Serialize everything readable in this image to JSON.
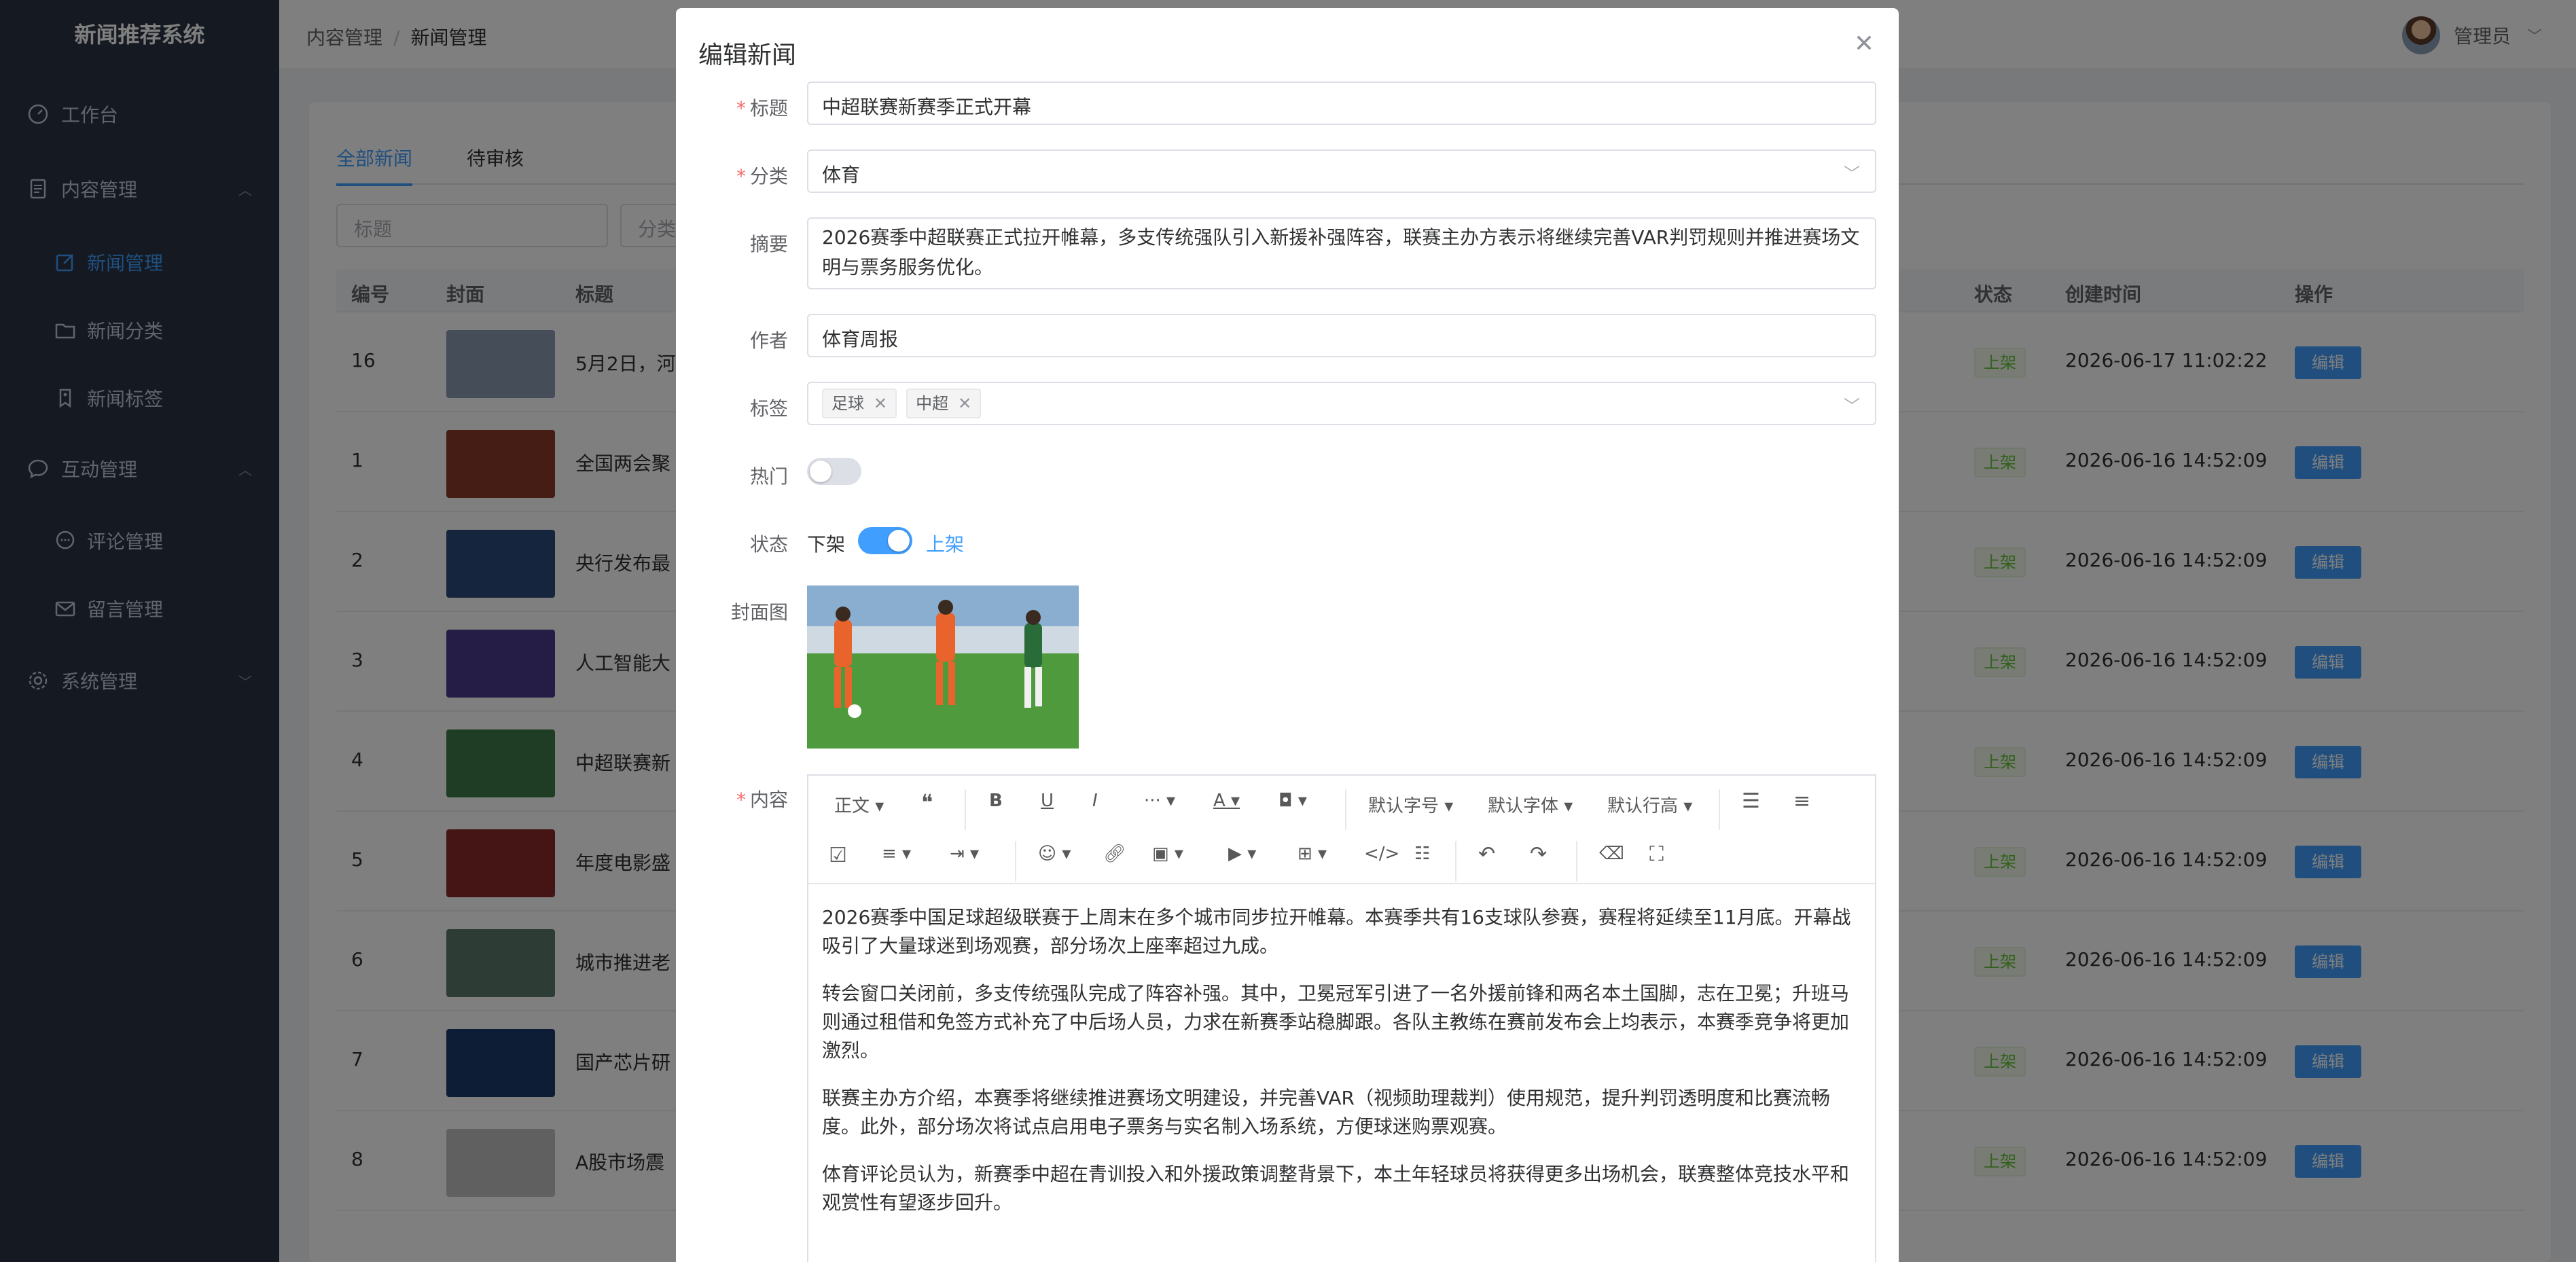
{
  "sidebar": {
    "title": "新闻推荐系统",
    "items": [
      {
        "label": "工作台"
      },
      {
        "label": "内容管理",
        "expanded": true
      },
      {
        "label": "新闻管理",
        "active": true
      },
      {
        "label": "新闻分类"
      },
      {
        "label": "新闻标签"
      },
      {
        "label": "互动管理",
        "expanded": true
      },
      {
        "label": "评论管理"
      },
      {
        "label": "留言管理"
      },
      {
        "label": "系统管理",
        "expanded": false
      }
    ]
  },
  "header": {
    "breadcrumb": [
      "内容管理",
      "新闻管理"
    ],
    "user": "管理员"
  },
  "main": {
    "tabs": [
      "全部新闻",
      "待审核"
    ],
    "filters": {
      "title_placeholder": "标题",
      "category_placeholder": "分类"
    },
    "columns": [
      "编号",
      "封面",
      "标题",
      "状态",
      "创建时间",
      "操作"
    ],
    "rows": [
      {
        "id": "16",
        "title": "5月2日，河",
        "status": "上架",
        "time": "2026-06-17 11:02:22",
        "action": "编辑"
      },
      {
        "id": "1",
        "title": "全国两会聚",
        "status": "上架",
        "time": "2026-06-16 14:52:09",
        "action": "编辑"
      },
      {
        "id": "2",
        "title": "央行发布最",
        "status": "上架",
        "time": "2026-06-16 14:52:09",
        "action": "编辑"
      },
      {
        "id": "3",
        "title": "人工智能大",
        "status": "上架",
        "time": "2026-06-16 14:52:09",
        "action": "编辑"
      },
      {
        "id": "4",
        "title": "中超联赛新",
        "status": "上架",
        "time": "2026-06-16 14:52:09",
        "action": "编辑"
      },
      {
        "id": "5",
        "title": "年度电影盛",
        "status": "上架",
        "time": "2026-06-16 14:52:09",
        "action": "编辑"
      },
      {
        "id": "6",
        "title": "城市推进老",
        "status": "上架",
        "time": "2026-06-16 14:52:09",
        "action": "编辑"
      },
      {
        "id": "7",
        "title": "国产芯片研",
        "status": "上架",
        "time": "2026-06-16 14:52:09",
        "action": "编辑"
      },
      {
        "id": "8",
        "title": "A股市场震",
        "status": "上架",
        "time": "2026-06-16 14:52:09",
        "action": "编辑"
      }
    ],
    "colors": {
      "primary": "#409eff",
      "success": "#67c23a"
    }
  },
  "dialog": {
    "title": "编辑新闻",
    "labels": {
      "title": "标题",
      "category": "分类",
      "summary": "摘要",
      "author": "作者",
      "tags": "标签",
      "hot": "热门",
      "status": "状态",
      "cover": "封面图",
      "content": "内容"
    },
    "values": {
      "title": "中超联赛新赛季正式开幕",
      "category": "体育",
      "summary": "2026赛季中超联赛正式拉开帷幕，多支传统强队引入新援补强阵容，联赛主办方表示将继续完善VAR判罚规则并推进赛场文明与票务服务优化。",
      "author": "体育周报",
      "tags": [
        "足球",
        "中超"
      ],
      "hot": false,
      "status_off": "下架",
      "status_on": "上架",
      "status": true
    },
    "toolbar": {
      "paragraph": "正文",
      "font_size": "默认字号",
      "font_family": "默认字体",
      "line_height": "默认行高"
    },
    "content": [
      "2026赛季中国足球超级联赛于上周末在多个城市同步拉开帷幕。本赛季共有16支球队参赛，赛程将延续至11月底。开幕战吸引了大量球迷到场观赛，部分场次上座率超过九成。",
      "转会窗口关闭前，多支传统强队完成了阵容补强。其中，卫冕冠军引进了一名外援前锋和两名本土国脚，志在卫冕；升班马则通过租借和免签方式补充了中后场人员，力求在新赛季站稳脚跟。各队主教练在赛前发布会上均表示，本赛季竞争将更加激烈。",
      "联赛主办方介绍，本赛季将继续推进赛场文明建设，并完善VAR（视频助理裁判）使用规范，提升判罚透明度和比赛流畅度。此外，部分场次将试点启用电子票务与实名制入场系统，方便球迷购票观赛。",
      "体育评论员认为，新赛季中超在青训投入和外援政策调整背景下，本土年轻球员将获得更多出场机会，联赛整体竞技水平和观赏性有望逐步回升。"
    ]
  }
}
